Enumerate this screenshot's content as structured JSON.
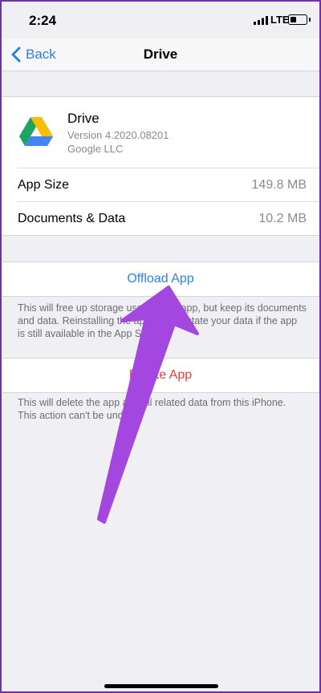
{
  "status_bar": {
    "time": "2:24",
    "network": "LTE"
  },
  "nav": {
    "back_label": "Back",
    "title": "Drive"
  },
  "app": {
    "name": "Drive",
    "version": "Version 4.2020.08201",
    "vendor": "Google LLC",
    "rows": [
      {
        "label": "App Size",
        "value": "149.8 MB"
      },
      {
        "label": "Documents & Data",
        "value": "10.2 MB"
      }
    ]
  },
  "offload": {
    "label": "Offload App",
    "description": "This will free up storage used by the app, but keep its documents and data. Reinstalling the app will reinstate your data if the app is still available in the App Store."
  },
  "delete": {
    "label": "Delete App",
    "description": "This will delete the app and all related data from this iPhone. This action can't be undone."
  },
  "colors": {
    "accent": "#2f7fe0",
    "destructive": "#e0403a",
    "annotation_arrow": "#a347e0"
  },
  "icons": [
    "chevron-left-icon",
    "google-drive-icon",
    "cellular-signal-icon",
    "battery-icon",
    "arrow-annotation"
  ]
}
